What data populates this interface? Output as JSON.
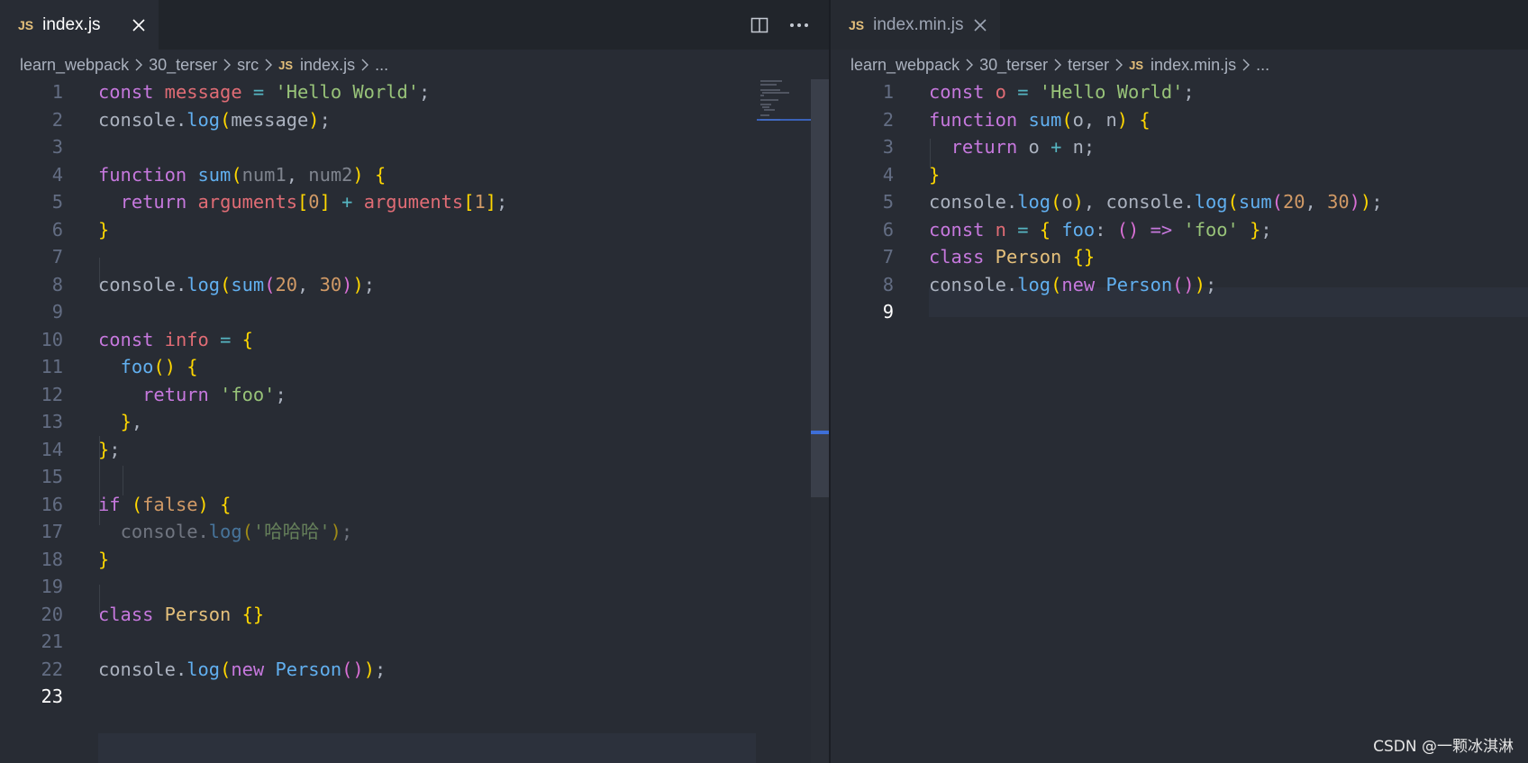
{
  "colors": {
    "background": "#282c34",
    "tabbar": "#21252b",
    "keyword": "#c678dd",
    "variable": "#e06c75",
    "string": "#98c379",
    "function": "#61afef",
    "number": "#d19a66",
    "class": "#e5c07b"
  },
  "icons": {
    "js_file": "JS",
    "split_editor": "split-editor-icon",
    "more_actions": "ellipsis-icon",
    "close": "close-icon",
    "breadcrumb_separator": "chevron-right-icon"
  },
  "left": {
    "tab": {
      "label": "index.js",
      "icon": "JS"
    },
    "breadcrumb": [
      "learn_webpack",
      "30_terser",
      "src",
      "index.js",
      "..."
    ],
    "current_line": 23,
    "line_numbers": [
      "1",
      "2",
      "3",
      "4",
      "5",
      "6",
      "7",
      "8",
      "9",
      "10",
      "11",
      "12",
      "13",
      "14",
      "15",
      "16",
      "17",
      "18",
      "19",
      "20",
      "21",
      "22",
      "23"
    ],
    "code": [
      "const message = 'Hello World';",
      "console.log(message);",
      "",
      "function sum(num1, num2) {",
      "  return arguments[0] + arguments[1];",
      "}",
      "",
      "console.log(sum(20, 30));",
      "",
      "const info = {",
      "  foo() {",
      "    return 'foo';",
      "  },",
      "};",
      "",
      "if (false) {",
      "  console.log('哈哈哈');",
      "}",
      "",
      "class Person {}",
      "",
      "console.log(new Person());",
      ""
    ]
  },
  "right": {
    "tab": {
      "label": "index.min.js",
      "icon": "JS"
    },
    "breadcrumb": [
      "learn_webpack",
      "30_terser",
      "terser",
      "index.min.js",
      "..."
    ],
    "current_line": 9,
    "line_numbers": [
      "1",
      "2",
      "3",
      "4",
      "5",
      "6",
      "7",
      "8",
      "9"
    ],
    "code": [
      "const o = 'Hello World';",
      "function sum(o, n) {",
      "  return o + n;",
      "}",
      "console.log(o), console.log(sum(20, 30));",
      "const n = { foo: () => 'foo' };",
      "class Person {}",
      "console.log(new Person());",
      ""
    ]
  },
  "watermark": "CSDN @一颗冰淇淋"
}
